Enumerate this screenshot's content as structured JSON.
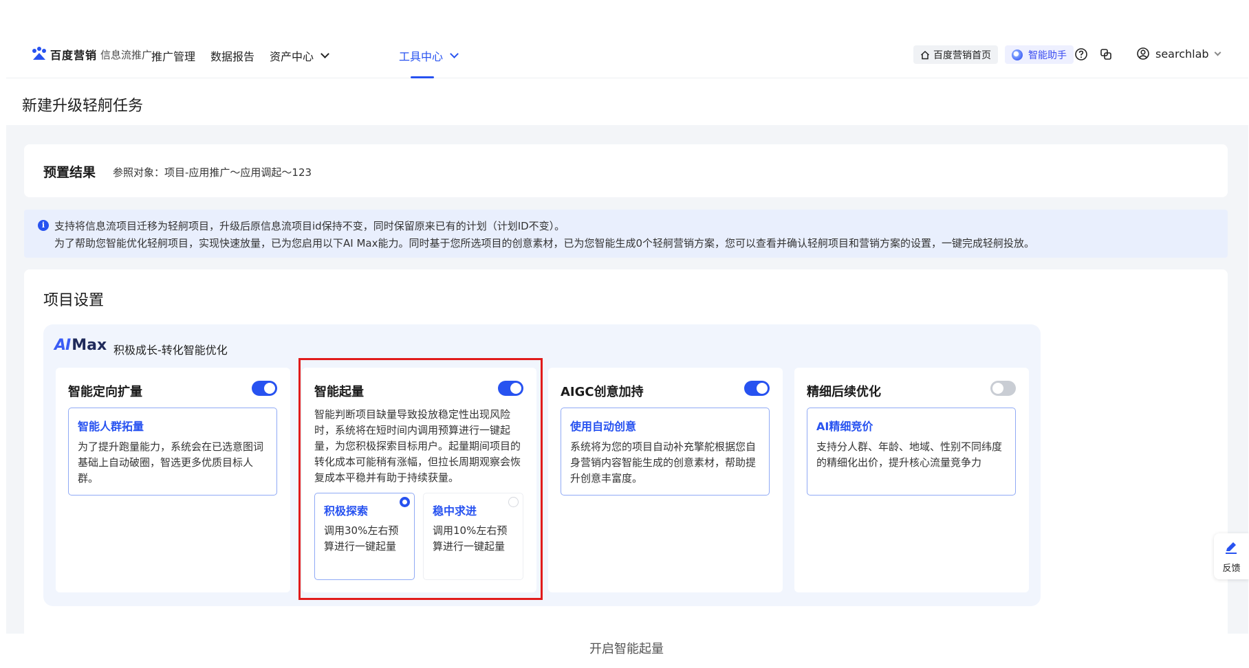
{
  "nav": {
    "logo_brand": "百度营销",
    "logo_sub": "信息流推广",
    "items": [
      {
        "label": "推广管理"
      },
      {
        "label": "数据报告"
      },
      {
        "label": "资产中心"
      },
      {
        "label": "工具中心"
      }
    ],
    "active_item": "工具中心",
    "home_label": "百度营销首页",
    "assistant_label": "智能助手",
    "username": "searchlab",
    "accent_color": "#2752f0"
  },
  "page": {
    "title": "新建升级轻舸任务"
  },
  "preset": {
    "title": "预置结果",
    "reference": "参照对象：项目-应用推广～应用调起～123"
  },
  "banner": {
    "line1": "支持将信息流项目迁移为轻舸项目，升级后原信息流项目id保持不变，同时保留原来已有的计划（计划ID不变）。",
    "line2": "为了帮助您智能优化轻舸项目，实现快速放量，已为您启用以下AI Max能力。同时基于您所选项目的创意素材，已为您智能生成0个轻舸营销方案，您可以查看并确认轻舸项目和营销方案的设置，一键完成轻舸投放。"
  },
  "settings": {
    "title": "项目设置",
    "aimax_ai": "AI",
    "aimax_max": "Max",
    "aimax_subtitle": "积极成长-转化智能优化",
    "cards": [
      {
        "title": "智能定向扩量",
        "enabled": true,
        "feature_title": "智能人群拓量",
        "feature_desc": "为了提升跑量能力，系统会在已选意图词基础上自动破圈，智选更多优质目标人群。"
      },
      {
        "title": "智能起量",
        "enabled": true,
        "desc": "智能判断项目缺量导致投放稳定性出现风险时，系统将在短时间内调用预算进行一键起量，为您积极探索目标用户。起量期间项目的转化成本可能稍有涨幅，但拉长周期观察会恢复成本平稳并有助于持续获量。",
        "options": [
          {
            "title": "积极探索",
            "desc": "调用30%左右预算进行一键起量",
            "selected": true
          },
          {
            "title": "稳中求进",
            "desc": "调用10%左右预算进行一键起量",
            "selected": false
          }
        ]
      },
      {
        "title": "AIGC创意加持",
        "enabled": true,
        "feature_title": "使用自动创意",
        "feature_desc": "系统将为您的项目自动补充擎舵根据您自身营销内容智能生成的创意素材，帮助提升创意丰富度。"
      },
      {
        "title": "精细后续优化",
        "enabled": false,
        "feature_title": "AI精细竞价",
        "feature_desc": "支持分人群、年龄、地域、性别不同纬度的精细化出价，提升核心流量竞争力"
      }
    ]
  },
  "feedback_label": "反馈",
  "caption": "开启智能起量"
}
